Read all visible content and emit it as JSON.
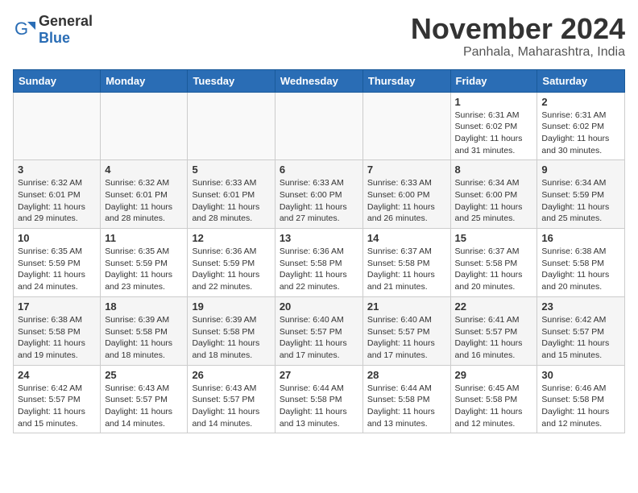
{
  "logo": {
    "text_general": "General",
    "text_blue": "Blue"
  },
  "title": {
    "month": "November 2024",
    "location": "Panhala, Maharashtra, India"
  },
  "weekdays": [
    "Sunday",
    "Monday",
    "Tuesday",
    "Wednesday",
    "Thursday",
    "Friday",
    "Saturday"
  ],
  "weeks": [
    [
      {
        "day": "",
        "info": ""
      },
      {
        "day": "",
        "info": ""
      },
      {
        "day": "",
        "info": ""
      },
      {
        "day": "",
        "info": ""
      },
      {
        "day": "",
        "info": ""
      },
      {
        "day": "1",
        "info": "Sunrise: 6:31 AM\nSunset: 6:02 PM\nDaylight: 11 hours and 31 minutes."
      },
      {
        "day": "2",
        "info": "Sunrise: 6:31 AM\nSunset: 6:02 PM\nDaylight: 11 hours and 30 minutes."
      }
    ],
    [
      {
        "day": "3",
        "info": "Sunrise: 6:32 AM\nSunset: 6:01 PM\nDaylight: 11 hours and 29 minutes."
      },
      {
        "day": "4",
        "info": "Sunrise: 6:32 AM\nSunset: 6:01 PM\nDaylight: 11 hours and 28 minutes."
      },
      {
        "day": "5",
        "info": "Sunrise: 6:33 AM\nSunset: 6:01 PM\nDaylight: 11 hours and 28 minutes."
      },
      {
        "day": "6",
        "info": "Sunrise: 6:33 AM\nSunset: 6:00 PM\nDaylight: 11 hours and 27 minutes."
      },
      {
        "day": "7",
        "info": "Sunrise: 6:33 AM\nSunset: 6:00 PM\nDaylight: 11 hours and 26 minutes."
      },
      {
        "day": "8",
        "info": "Sunrise: 6:34 AM\nSunset: 6:00 PM\nDaylight: 11 hours and 25 minutes."
      },
      {
        "day": "9",
        "info": "Sunrise: 6:34 AM\nSunset: 5:59 PM\nDaylight: 11 hours and 25 minutes."
      }
    ],
    [
      {
        "day": "10",
        "info": "Sunrise: 6:35 AM\nSunset: 5:59 PM\nDaylight: 11 hours and 24 minutes."
      },
      {
        "day": "11",
        "info": "Sunrise: 6:35 AM\nSunset: 5:59 PM\nDaylight: 11 hours and 23 minutes."
      },
      {
        "day": "12",
        "info": "Sunrise: 6:36 AM\nSunset: 5:59 PM\nDaylight: 11 hours and 22 minutes."
      },
      {
        "day": "13",
        "info": "Sunrise: 6:36 AM\nSunset: 5:58 PM\nDaylight: 11 hours and 22 minutes."
      },
      {
        "day": "14",
        "info": "Sunrise: 6:37 AM\nSunset: 5:58 PM\nDaylight: 11 hours and 21 minutes."
      },
      {
        "day": "15",
        "info": "Sunrise: 6:37 AM\nSunset: 5:58 PM\nDaylight: 11 hours and 20 minutes."
      },
      {
        "day": "16",
        "info": "Sunrise: 6:38 AM\nSunset: 5:58 PM\nDaylight: 11 hours and 20 minutes."
      }
    ],
    [
      {
        "day": "17",
        "info": "Sunrise: 6:38 AM\nSunset: 5:58 PM\nDaylight: 11 hours and 19 minutes."
      },
      {
        "day": "18",
        "info": "Sunrise: 6:39 AM\nSunset: 5:58 PM\nDaylight: 11 hours and 18 minutes."
      },
      {
        "day": "19",
        "info": "Sunrise: 6:39 AM\nSunset: 5:58 PM\nDaylight: 11 hours and 18 minutes."
      },
      {
        "day": "20",
        "info": "Sunrise: 6:40 AM\nSunset: 5:57 PM\nDaylight: 11 hours and 17 minutes."
      },
      {
        "day": "21",
        "info": "Sunrise: 6:40 AM\nSunset: 5:57 PM\nDaylight: 11 hours and 17 minutes."
      },
      {
        "day": "22",
        "info": "Sunrise: 6:41 AM\nSunset: 5:57 PM\nDaylight: 11 hours and 16 minutes."
      },
      {
        "day": "23",
        "info": "Sunrise: 6:42 AM\nSunset: 5:57 PM\nDaylight: 11 hours and 15 minutes."
      }
    ],
    [
      {
        "day": "24",
        "info": "Sunrise: 6:42 AM\nSunset: 5:57 PM\nDaylight: 11 hours and 15 minutes."
      },
      {
        "day": "25",
        "info": "Sunrise: 6:43 AM\nSunset: 5:57 PM\nDaylight: 11 hours and 14 minutes."
      },
      {
        "day": "26",
        "info": "Sunrise: 6:43 AM\nSunset: 5:57 PM\nDaylight: 11 hours and 14 minutes."
      },
      {
        "day": "27",
        "info": "Sunrise: 6:44 AM\nSunset: 5:58 PM\nDaylight: 11 hours and 13 minutes."
      },
      {
        "day": "28",
        "info": "Sunrise: 6:44 AM\nSunset: 5:58 PM\nDaylight: 11 hours and 13 minutes."
      },
      {
        "day": "29",
        "info": "Sunrise: 6:45 AM\nSunset: 5:58 PM\nDaylight: 11 hours and 12 minutes."
      },
      {
        "day": "30",
        "info": "Sunrise: 6:46 AM\nSunset: 5:58 PM\nDaylight: 11 hours and 12 minutes."
      }
    ]
  ]
}
